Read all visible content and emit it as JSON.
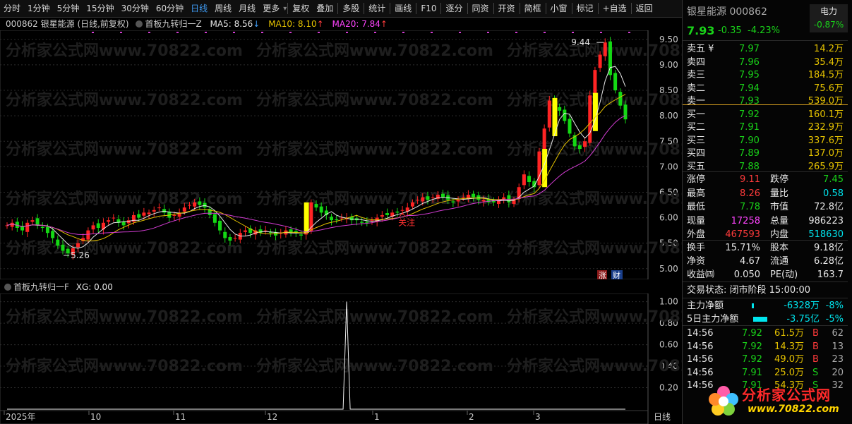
{
  "toolbar": {
    "items": [
      "分时",
      "1分钟",
      "5分钟",
      "15分钟",
      "30分钟",
      "60分钟",
      "日线",
      "周线",
      "月线",
      "更多",
      "复权",
      "叠加",
      "多股",
      "统计",
      "画线",
      "F10",
      "逐分",
      "同资",
      "开资",
      "简框",
      "小窗",
      "标记",
      "+自选",
      "返回"
    ],
    "active_index": 6
  },
  "main_header": {
    "code_name": "000862 银星能源 (日线,前复权)",
    "indicator": "首板九转归一Z",
    "ma5_label": "MA5: 8.56",
    "ma5_arrow": "↓",
    "ma10_label": "MA10: 8.10",
    "ma10_arrow": "↑",
    "ma20_label": "MA20: 7.84",
    "ma20_arrow": "↑"
  },
  "sub_header": {
    "indicator": "首板九转归一F",
    "xg_label": "XG: 0.00"
  },
  "watermark": "分析家公式网www.70822.com",
  "main_axis": {
    "ticks": [
      "9.50",
      "9.00",
      "8.50",
      "8.00",
      "7.50",
      "7.00",
      "6.50",
      "6.00",
      "5.50",
      "5.00"
    ]
  },
  "sub_axis": {
    "ticks": [
      "1.00",
      "0.80",
      "0.60",
      "0.40",
      "0.20"
    ]
  },
  "time_axis": {
    "labels": [
      "2025年",
      "10",
      "11",
      "12",
      "1",
      "2",
      "3"
    ],
    "period": "日线"
  },
  "annotations": {
    "high": "9.44",
    "low": "5.26",
    "attention": "关注"
  },
  "chart_badges": {
    "zhang": "涨",
    "cai": "财"
  },
  "chart_data": {
    "type": "candlestick",
    "y_range": [
      4.9,
      9.65
    ],
    "sub_y_range": [
      0,
      1.05
    ],
    "close_approx": [
      5.85,
      5.9,
      5.8,
      5.75,
      5.9,
      5.95,
      5.85,
      5.8,
      5.7,
      5.6,
      5.45,
      5.35,
      5.3,
      5.4,
      5.5,
      5.6,
      5.75,
      5.85,
      5.8,
      5.9,
      5.95,
      6.0,
      5.9,
      5.85,
      5.95,
      6.05,
      6.0,
      6.1,
      6.1,
      6.15,
      6.2,
      6.1,
      6.0,
      6.05,
      6.1,
      6.2,
      6.25,
      6.3,
      6.25,
      6.2,
      6.05,
      5.9,
      5.75,
      5.6,
      5.55,
      5.6,
      5.7,
      5.75,
      5.7,
      5.75,
      5.7,
      5.75,
      5.7,
      5.65,
      5.7,
      5.75,
      5.7,
      5.7,
      5.65,
      5.7,
      6.3,
      6.2,
      6.1,
      6.05,
      5.95,
      5.95,
      6.0,
      6.0,
      5.95,
      5.95,
      5.9,
      5.9,
      5.95,
      6.0,
      6.05,
      6.05,
      6.1,
      6.1,
      6.15,
      6.2,
      6.3,
      6.35,
      6.4,
      6.35,
      6.4,
      6.45,
      6.4,
      6.35,
      6.3,
      6.35,
      6.4,
      6.45,
      6.4,
      6.35,
      6.35,
      6.3,
      6.3,
      6.35,
      6.4,
      6.3,
      6.35,
      6.6,
      6.85,
      6.7,
      6.6,
      7.3,
      7.75,
      8.3,
      8.2,
      8.1,
      7.9,
      7.65,
      7.4,
      7.35,
      7.5,
      8.4,
      8.9,
      9.2,
      9.44,
      8.8,
      8.5,
      8.2,
      7.93
    ],
    "ma5_last": 8.56,
    "ma10_last": 8.1,
    "ma20_last": 7.84,
    "xg_signal_index": 67,
    "xg_value": 1.0
  },
  "quote": {
    "name_code": "银星能源 000862",
    "sector": "电力",
    "sector_pct": "-0.87%",
    "price": "7.93",
    "change": "-0.35",
    "change_pct": "-4.23%"
  },
  "order_book": [
    {
      "label": "卖五 ¥",
      "price": "7.97",
      "vol": "14.2万"
    },
    {
      "label": "卖四",
      "price": "7.96",
      "vol": "35.4万"
    },
    {
      "label": "卖三",
      "price": "7.95",
      "vol": "184.5万"
    },
    {
      "label": "卖二",
      "price": "7.94",
      "vol": "75.6万"
    },
    {
      "label": "卖一",
      "price": "7.93",
      "vol": "539.0万"
    },
    {
      "label": "买一",
      "price": "7.92",
      "vol": "160.1万"
    },
    {
      "label": "买二",
      "price": "7.91",
      "vol": "232.9万"
    },
    {
      "label": "买三",
      "price": "7.90",
      "vol": "337.6万"
    },
    {
      "label": "买四",
      "price": "7.89",
      "vol": "137.0万"
    },
    {
      "label": "买五",
      "price": "7.88",
      "vol": "265.9万"
    }
  ],
  "stats": [
    {
      "l1": "涨停",
      "v1": "9.11",
      "l2": "跌停",
      "v2": "7.45"
    },
    {
      "l1": "最高",
      "v1": "8.26",
      "l2": "量比",
      "v2": "0.58"
    },
    {
      "l1": "最低",
      "v1": "7.78",
      "l2": "市值",
      "v2": "72.8亿"
    },
    {
      "l1": "现量",
      "v1": "17258",
      "l2": "总量",
      "v2": "986223"
    },
    {
      "l1": "外盘",
      "v1": "467593",
      "l2": "内盘",
      "v2": "518630"
    }
  ],
  "stats2": [
    {
      "l1": "换手",
      "v1": "15.71%",
      "l2": "股本",
      "v2": "9.18亿"
    },
    {
      "l1": "净资",
      "v1": "4.67",
      "l2": "流通",
      "v2": "6.28亿"
    },
    {
      "l1": "收益㈣",
      "v1": "0.050",
      "l2": "PE(动)",
      "v2": "163.7"
    }
  ],
  "status": "交易状态: 闭市阶段 15:00:00",
  "flow": [
    {
      "label": "主力净额",
      "value": "-6328万",
      "pct": "-8%"
    },
    {
      "label": "5日主力净额",
      "value": "-3.75亿",
      "pct": "-5%"
    }
  ],
  "ticks": [
    {
      "time": "14:56",
      "price": "7.92",
      "vol": "61.5万",
      "side": "B",
      "n": "62"
    },
    {
      "time": "14:56",
      "price": "7.92",
      "vol": "14.3万",
      "side": "B",
      "n": "13"
    },
    {
      "time": "14:56",
      "price": "7.92",
      "vol": "49.0万",
      "side": "B",
      "n": "23"
    },
    {
      "time": "14:56",
      "price": "7.91",
      "vol": "25.0万",
      "side": "S",
      "n": "20"
    },
    {
      "time": "14:56",
      "price": "7.91",
      "vol": "54.3万",
      "side": "S",
      "n": "32"
    }
  ],
  "logo": {
    "title": "分析家公式网",
    "url": "www.70822.com"
  }
}
